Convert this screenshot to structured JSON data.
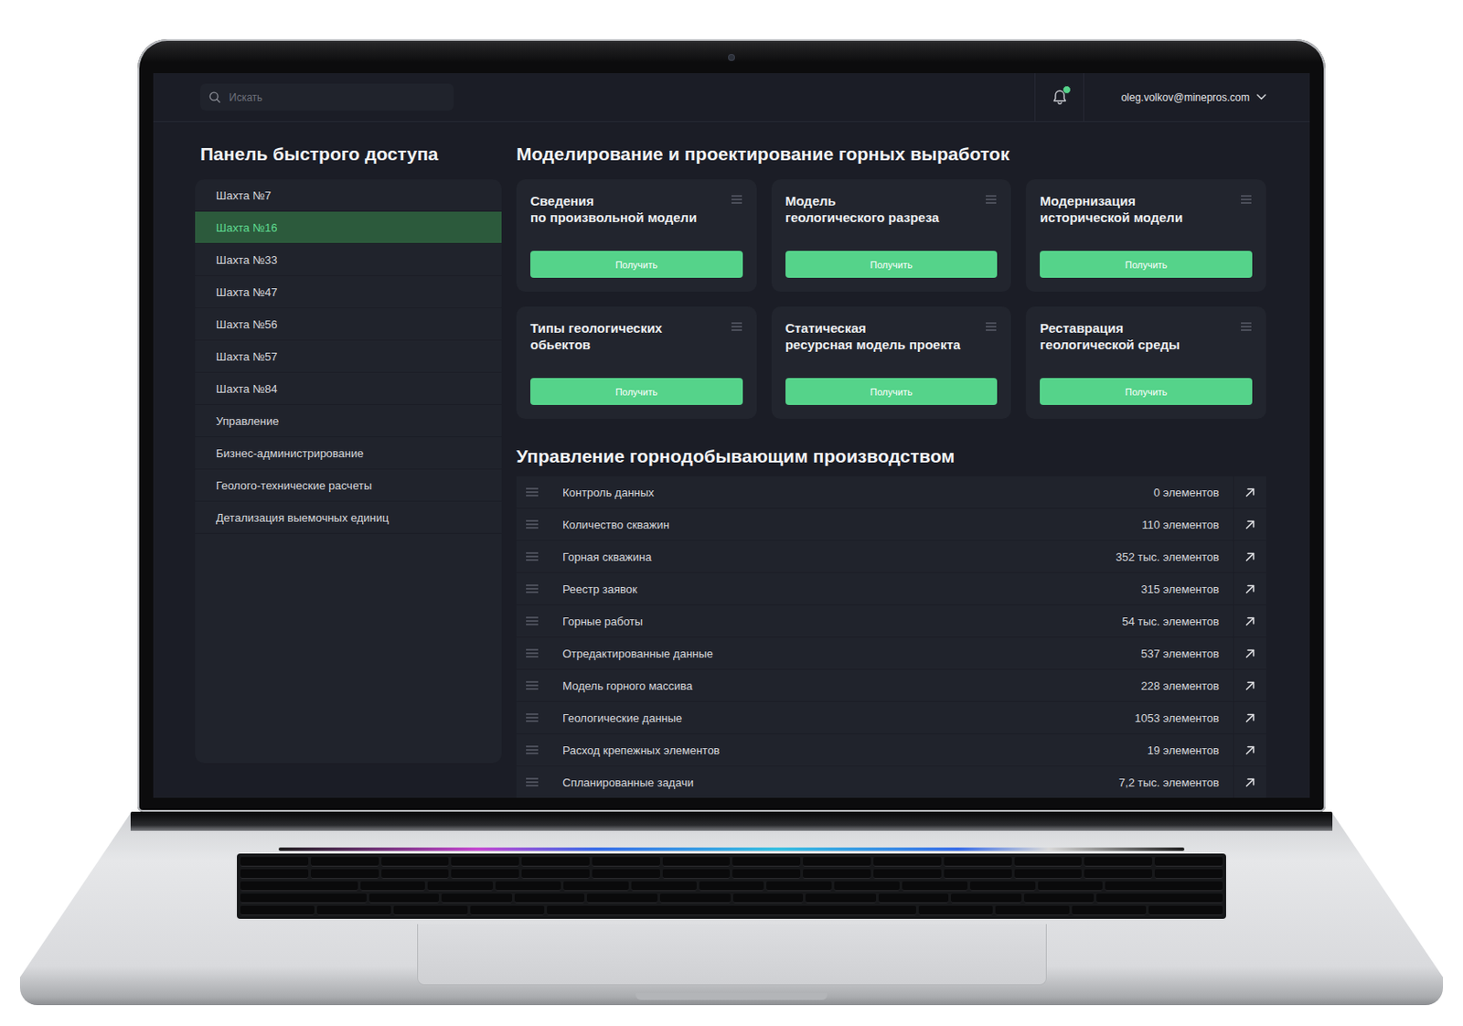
{
  "search": {
    "placeholder": "Искать"
  },
  "notifications": {
    "unread": true
  },
  "user": {
    "email": "oleg.volkov@minepros.com"
  },
  "quick_access": {
    "title": "Панель быстрого доступа",
    "items": [
      {
        "label": "Шахта №7",
        "selected": false
      },
      {
        "label": "Шахта №16",
        "selected": true
      },
      {
        "label": "Шахта №33",
        "selected": false
      },
      {
        "label": "Шахта №47",
        "selected": false
      },
      {
        "label": "Шахта №56",
        "selected": false
      },
      {
        "label": "Шахта №57",
        "selected": false
      },
      {
        "label": "Шахта №84",
        "selected": false
      },
      {
        "label": "Управление",
        "selected": false
      },
      {
        "label": "Бизнес-администрирование",
        "selected": false
      },
      {
        "label": "Геолого-технические расчеты",
        "selected": false
      },
      {
        "label": "Детализация выемочных единиц",
        "selected": false
      }
    ]
  },
  "modeling": {
    "title": "Моделирование и проектирование горных выработок",
    "cards": [
      {
        "title": [
          "Сведения",
          "по произвольной модели"
        ],
        "button": "Получить"
      },
      {
        "title": [
          "Модель",
          "геологического разреза"
        ],
        "button": "Получить"
      },
      {
        "title": [
          "Модернизация",
          "исторической модели"
        ],
        "button": "Получить"
      },
      {
        "title": [
          "Типы геологических",
          "обьектов"
        ],
        "button": "Получить"
      },
      {
        "title": [
          "Статическая",
          "ресурсная модель проекта"
        ],
        "button": "Получить"
      },
      {
        "title": [
          "Реставрация",
          "геологической среды"
        ],
        "button": "Получить"
      }
    ]
  },
  "production": {
    "title": "Управление горнодобывающим производством",
    "rows": [
      {
        "name": "Контроль данных",
        "count": "0 элементов"
      },
      {
        "name": "Количество скважин",
        "count": "110 элементов"
      },
      {
        "name": "Горная скважина",
        "count": "352 тыс. элементов"
      },
      {
        "name": "Реестр заявок",
        "count": "315 элементов"
      },
      {
        "name": "Горные работы",
        "count": "54 тыс. элементов"
      },
      {
        "name": "Отредактированные данные",
        "count": "537 элементов"
      },
      {
        "name": "Модель горного массива",
        "count": "228 элементов"
      },
      {
        "name": "Геологические данные",
        "count": "1053 элементов"
      },
      {
        "name": "Расход крепежных элементов",
        "count": "19 элементов"
      },
      {
        "name": "Спланированные задачи",
        "count": "7,2 тыс. элементов"
      }
    ]
  }
}
